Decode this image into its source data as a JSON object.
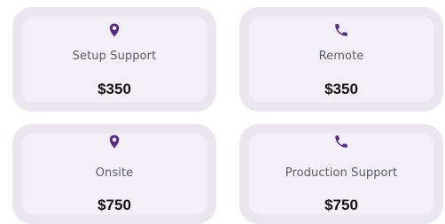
{
  "colors": {
    "accent": "#5a2a82",
    "card_outer": "#ebe5ef",
    "card_inner": "#f3eff6",
    "label_text": "#5b5b63",
    "price_text": "#141414"
  },
  "cards": [
    {
      "icon": "map-pin-icon",
      "label": "Setup Support",
      "price": "$350"
    },
    {
      "icon": "phone-icon",
      "label": "Remote",
      "price": "$350"
    },
    {
      "icon": "map-pin-icon",
      "label": "Onsite",
      "price": "$750"
    },
    {
      "icon": "phone-icon",
      "label": "Production Support",
      "price": "$750"
    }
  ]
}
